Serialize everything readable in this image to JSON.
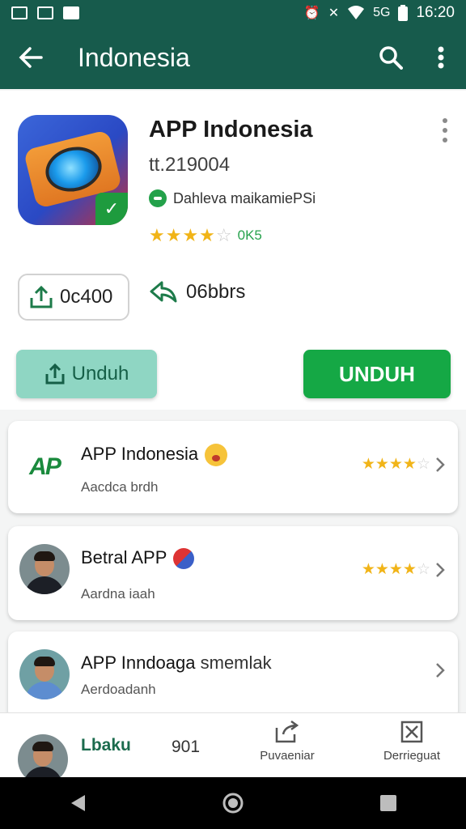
{
  "status_bar": {
    "time": "16:20",
    "signal_text": "5G",
    "icons": [
      "gallery-icon",
      "image-icon",
      "app-icon",
      "alarm-icon",
      "mute-icon",
      "wifi-icon",
      "signal-icon",
      "battery-icon"
    ]
  },
  "app_bar": {
    "title": "Indonesia",
    "back_icon": "arrow-back-icon",
    "search_icon": "search-icon",
    "menu_icon": "more-vert-icon"
  },
  "app": {
    "title": "APP Indonesia",
    "version": "tt.219004",
    "developer": "Dahleva maikamiePSi",
    "rating_stars": 3.5,
    "rating_text": "0K5",
    "download_count": "0c400",
    "share_count": "06bbrs"
  },
  "buttons": {
    "secondary_label": "Unduh",
    "primary_label": "UNDUH"
  },
  "list": [
    {
      "name": "APP Indonesia",
      "sub": "Aacdca brdh",
      "stars": 3.5,
      "logo_text": "AP"
    },
    {
      "name": "Betral APP",
      "sub": "Aardna iaah",
      "stars": 3.5
    },
    {
      "name": "APP Inndoaga",
      "name_suffix": "smemlak",
      "sub": "Aerdoadanh"
    }
  ],
  "bottom_tabs": {
    "label": "Lbaku",
    "number": "901",
    "tab1_label": "Puvaeniar",
    "tab2_label": "Derrieguat"
  },
  "colors": {
    "header": "#175b4c",
    "primary": "#15a845",
    "secondary": "#8fd6c3",
    "star": "#f1b418"
  }
}
